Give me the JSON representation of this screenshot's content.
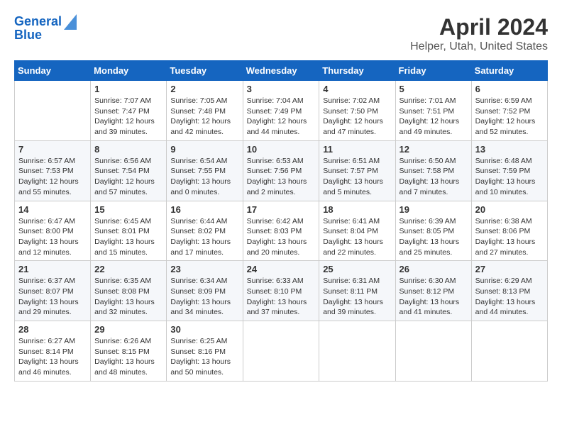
{
  "header": {
    "logo_line1": "General",
    "logo_line2": "Blue",
    "title": "April 2024",
    "subtitle": "Helper, Utah, United States"
  },
  "columns": [
    "Sunday",
    "Monday",
    "Tuesday",
    "Wednesday",
    "Thursday",
    "Friday",
    "Saturday"
  ],
  "weeks": [
    [
      {
        "day": "",
        "info": ""
      },
      {
        "day": "1",
        "info": "Sunrise: 7:07 AM\nSunset: 7:47 PM\nDaylight: 12 hours\nand 39 minutes."
      },
      {
        "day": "2",
        "info": "Sunrise: 7:05 AM\nSunset: 7:48 PM\nDaylight: 12 hours\nand 42 minutes."
      },
      {
        "day": "3",
        "info": "Sunrise: 7:04 AM\nSunset: 7:49 PM\nDaylight: 12 hours\nand 44 minutes."
      },
      {
        "day": "4",
        "info": "Sunrise: 7:02 AM\nSunset: 7:50 PM\nDaylight: 12 hours\nand 47 minutes."
      },
      {
        "day": "5",
        "info": "Sunrise: 7:01 AM\nSunset: 7:51 PM\nDaylight: 12 hours\nand 49 minutes."
      },
      {
        "day": "6",
        "info": "Sunrise: 6:59 AM\nSunset: 7:52 PM\nDaylight: 12 hours\nand 52 minutes."
      }
    ],
    [
      {
        "day": "7",
        "info": "Sunrise: 6:57 AM\nSunset: 7:53 PM\nDaylight: 12 hours\nand 55 minutes."
      },
      {
        "day": "8",
        "info": "Sunrise: 6:56 AM\nSunset: 7:54 PM\nDaylight: 12 hours\nand 57 minutes."
      },
      {
        "day": "9",
        "info": "Sunrise: 6:54 AM\nSunset: 7:55 PM\nDaylight: 13 hours\nand 0 minutes."
      },
      {
        "day": "10",
        "info": "Sunrise: 6:53 AM\nSunset: 7:56 PM\nDaylight: 13 hours\nand 2 minutes."
      },
      {
        "day": "11",
        "info": "Sunrise: 6:51 AM\nSunset: 7:57 PM\nDaylight: 13 hours\nand 5 minutes."
      },
      {
        "day": "12",
        "info": "Sunrise: 6:50 AM\nSunset: 7:58 PM\nDaylight: 13 hours\nand 7 minutes."
      },
      {
        "day": "13",
        "info": "Sunrise: 6:48 AM\nSunset: 7:59 PM\nDaylight: 13 hours\nand 10 minutes."
      }
    ],
    [
      {
        "day": "14",
        "info": "Sunrise: 6:47 AM\nSunset: 8:00 PM\nDaylight: 13 hours\nand 12 minutes."
      },
      {
        "day": "15",
        "info": "Sunrise: 6:45 AM\nSunset: 8:01 PM\nDaylight: 13 hours\nand 15 minutes."
      },
      {
        "day": "16",
        "info": "Sunrise: 6:44 AM\nSunset: 8:02 PM\nDaylight: 13 hours\nand 17 minutes."
      },
      {
        "day": "17",
        "info": "Sunrise: 6:42 AM\nSunset: 8:03 PM\nDaylight: 13 hours\nand 20 minutes."
      },
      {
        "day": "18",
        "info": "Sunrise: 6:41 AM\nSunset: 8:04 PM\nDaylight: 13 hours\nand 22 minutes."
      },
      {
        "day": "19",
        "info": "Sunrise: 6:39 AM\nSunset: 8:05 PM\nDaylight: 13 hours\nand 25 minutes."
      },
      {
        "day": "20",
        "info": "Sunrise: 6:38 AM\nSunset: 8:06 PM\nDaylight: 13 hours\nand 27 minutes."
      }
    ],
    [
      {
        "day": "21",
        "info": "Sunrise: 6:37 AM\nSunset: 8:07 PM\nDaylight: 13 hours\nand 29 minutes."
      },
      {
        "day": "22",
        "info": "Sunrise: 6:35 AM\nSunset: 8:08 PM\nDaylight: 13 hours\nand 32 minutes."
      },
      {
        "day": "23",
        "info": "Sunrise: 6:34 AM\nSunset: 8:09 PM\nDaylight: 13 hours\nand 34 minutes."
      },
      {
        "day": "24",
        "info": "Sunrise: 6:33 AM\nSunset: 8:10 PM\nDaylight: 13 hours\nand 37 minutes."
      },
      {
        "day": "25",
        "info": "Sunrise: 6:31 AM\nSunset: 8:11 PM\nDaylight: 13 hours\nand 39 minutes."
      },
      {
        "day": "26",
        "info": "Sunrise: 6:30 AM\nSunset: 8:12 PM\nDaylight: 13 hours\nand 41 minutes."
      },
      {
        "day": "27",
        "info": "Sunrise: 6:29 AM\nSunset: 8:13 PM\nDaylight: 13 hours\nand 44 minutes."
      }
    ],
    [
      {
        "day": "28",
        "info": "Sunrise: 6:27 AM\nSunset: 8:14 PM\nDaylight: 13 hours\nand 46 minutes."
      },
      {
        "day": "29",
        "info": "Sunrise: 6:26 AM\nSunset: 8:15 PM\nDaylight: 13 hours\nand 48 minutes."
      },
      {
        "day": "30",
        "info": "Sunrise: 6:25 AM\nSunset: 8:16 PM\nDaylight: 13 hours\nand 50 minutes."
      },
      {
        "day": "",
        "info": ""
      },
      {
        "day": "",
        "info": ""
      },
      {
        "day": "",
        "info": ""
      },
      {
        "day": "",
        "info": ""
      }
    ]
  ]
}
